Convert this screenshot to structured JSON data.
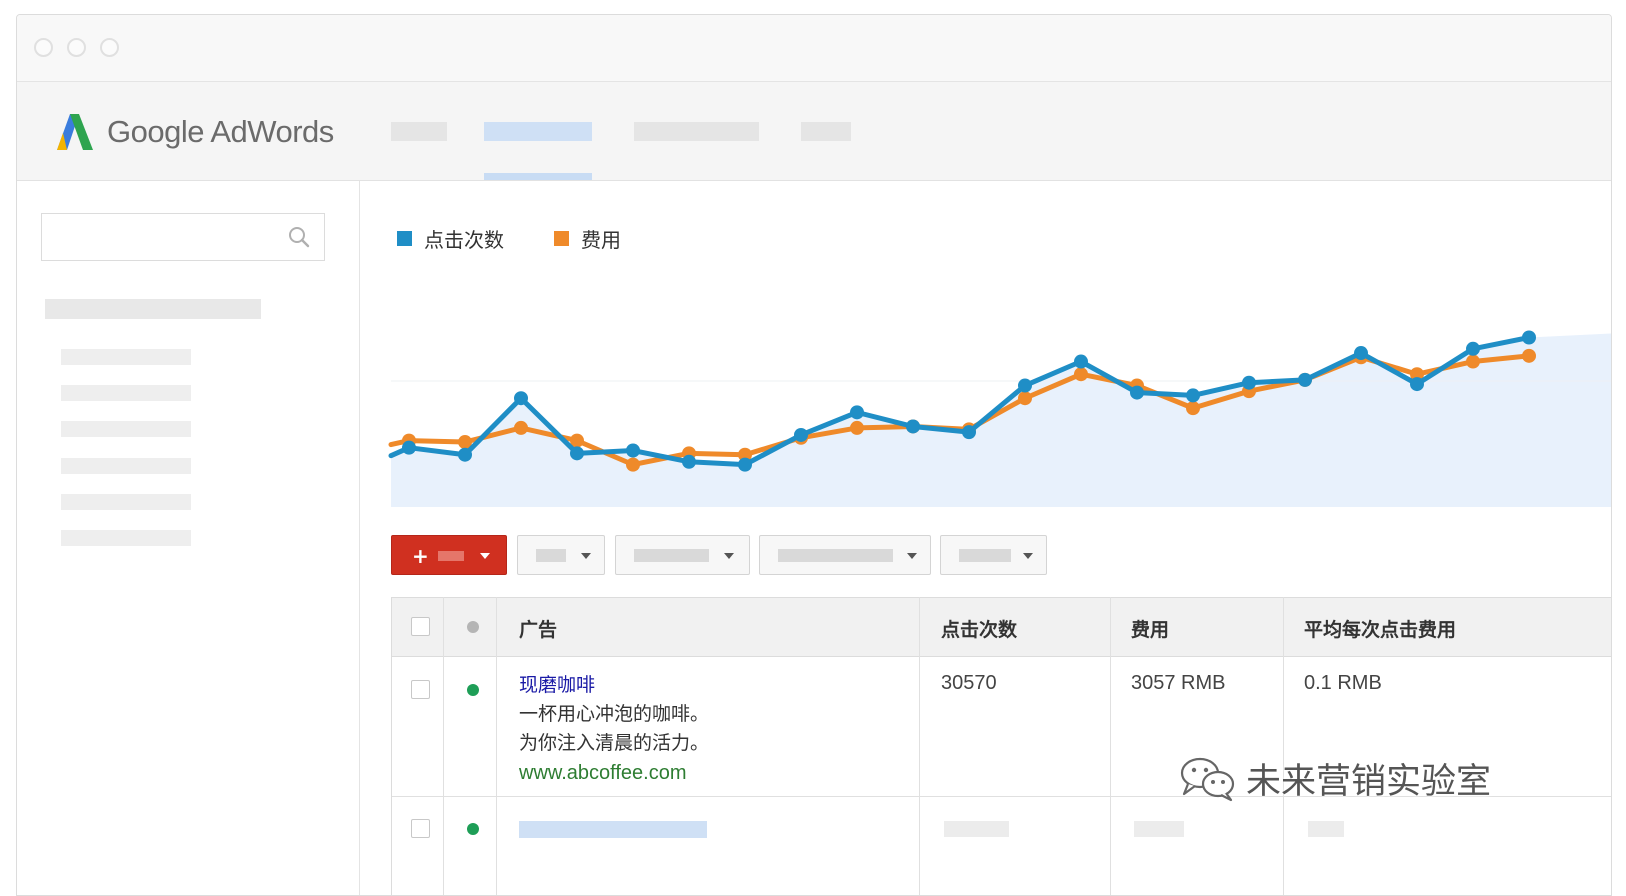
{
  "app": {
    "name": "Google AdWords"
  },
  "chart": {
    "legend": [
      {
        "label": "点击次数",
        "color": "#1f8ec6"
      },
      {
        "label": "费用",
        "color": "#ef8a2a"
      }
    ]
  },
  "chart_data": {
    "type": "line",
    "x": [
      1,
      2,
      3,
      4,
      5,
      6,
      7,
      8,
      9,
      10,
      11,
      12,
      13,
      14,
      15,
      16,
      17,
      18,
      19,
      20,
      21
    ],
    "series": [
      {
        "name": "点击次数",
        "color": "#1f8ec6",
        "values": [
          42,
          37,
          77,
          38,
          40,
          32,
          30,
          51,
          67,
          57,
          53,
          86,
          103,
          81,
          79,
          88,
          90,
          109,
          87,
          112,
          120
        ]
      },
      {
        "name": "费用",
        "color": "#ef8a2a",
        "values": [
          47,
          46,
          56,
          47,
          30,
          38,
          37,
          49,
          56,
          57,
          55,
          77,
          94,
          86,
          70,
          82,
          90,
          106,
          94,
          103,
          107
        ]
      }
    ],
    "ylim": [
      0,
      160
    ],
    "grid": false,
    "legend_position": "top-left",
    "area_fill": true
  },
  "table": {
    "headers": [
      "广告",
      "点击次数",
      "费用",
      "平均每次点击费用"
    ],
    "rows": [
      {
        "ad_title": "现磨咖啡",
        "ad_lines": [
          "一杯用心冲泡的咖啡。",
          "为你注入清晨的活力。"
        ],
        "ad_url": "www.abcoffee.com",
        "clicks": "30570",
        "cost": "3057 RMB",
        "avg_cpc": "0.1 RMB",
        "status_color": "#1e9e57"
      }
    ]
  },
  "watermark": {
    "text": "未来营销实验室"
  },
  "icons": {
    "search": "search-icon",
    "add": "plus-icon",
    "dropdown": "caret-down-icon",
    "wechat": "wechat-icon"
  }
}
